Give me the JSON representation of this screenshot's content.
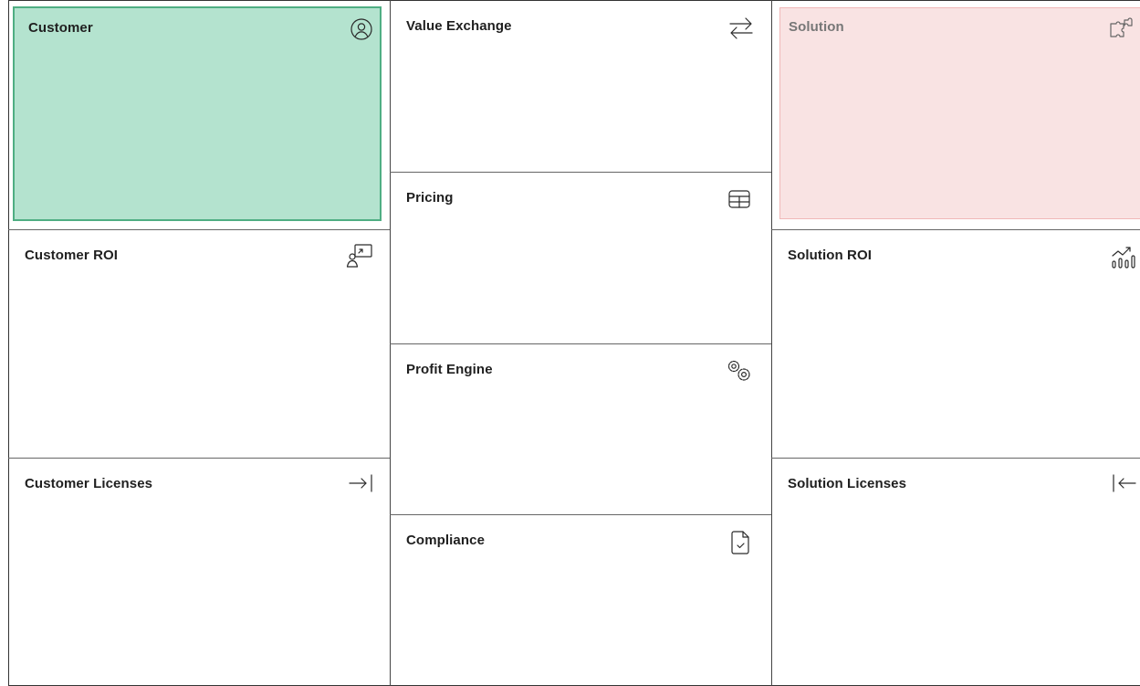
{
  "canvas": {
    "columns": {
      "left": [
        {
          "id": "customer",
          "title": "Customer",
          "icon": "user-circle-icon",
          "fill": "#b4e3cf",
          "border": "#4fae83"
        },
        {
          "id": "customer_roi",
          "title": "Customer ROI",
          "icon": "presentation-chart-icon"
        },
        {
          "id": "customer_licenses",
          "title": "Customer Licenses",
          "icon": "arrow-right-to-bar-icon"
        }
      ],
      "center": [
        {
          "id": "value_exchange",
          "title": "Value Exchange",
          "icon": "arrows-exchange-icon"
        },
        {
          "id": "pricing",
          "title": "Pricing",
          "icon": "table-icon"
        },
        {
          "id": "profit_engine",
          "title": "Profit Engine",
          "icon": "gears-icon"
        },
        {
          "id": "compliance",
          "title": "Compliance",
          "icon": "document-check-icon"
        }
      ],
      "right": [
        {
          "id": "solution",
          "title": "Solution",
          "icon": "puzzle-icon",
          "fill": "#f9e3e3",
          "border": "#f1b8b8"
        },
        {
          "id": "solution_roi",
          "title": "Solution ROI",
          "icon": "chart-growth-icon"
        },
        {
          "id": "solution_licenses",
          "title": "Solution Licenses",
          "icon": "arrow-left-from-bar-icon"
        }
      ]
    }
  }
}
